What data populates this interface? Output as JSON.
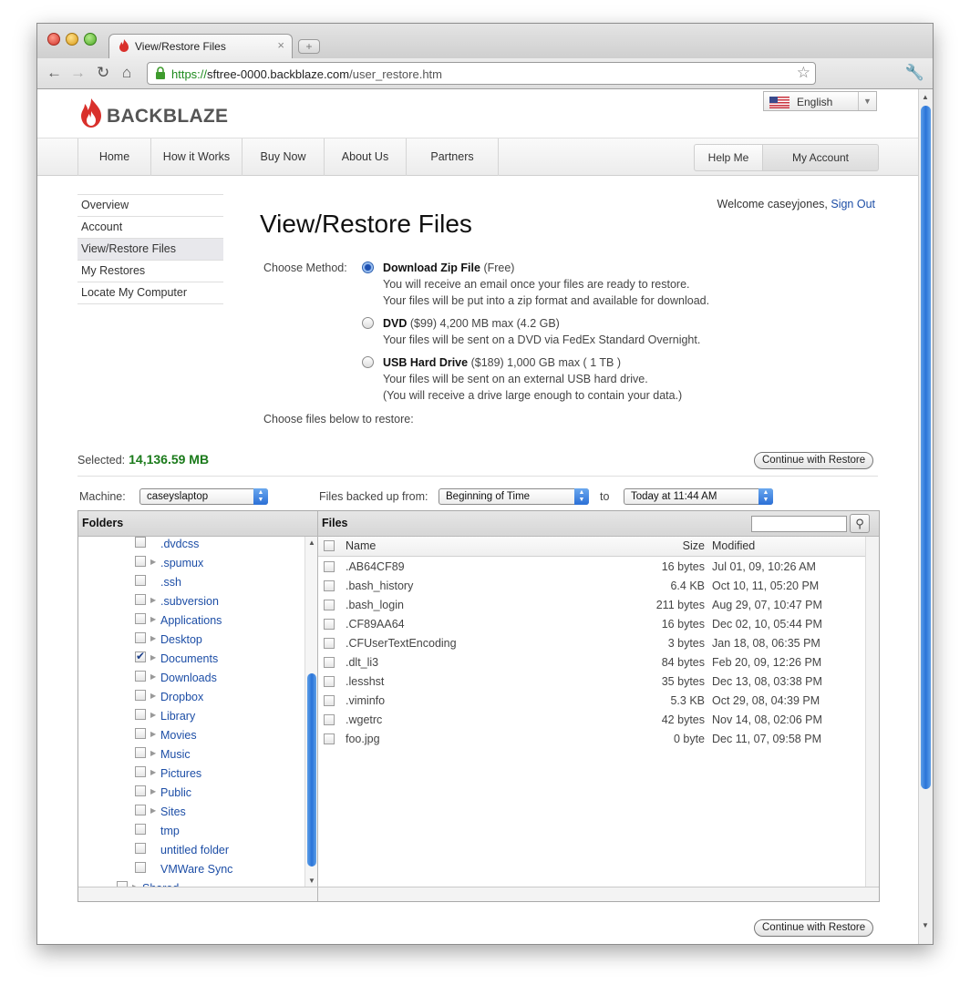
{
  "browser": {
    "tab_title": "View/Restore Files",
    "url_scheme": "https://",
    "url_host": "sftree-0000.backblaze.com",
    "url_path": "/user_restore.htm"
  },
  "site": {
    "logo_text": "BACKBLAZE",
    "language": "English"
  },
  "nav": {
    "items": [
      "Home",
      "How it Works",
      "Buy Now",
      "About Us",
      "Partners"
    ],
    "help": "Help Me",
    "account": "My Account"
  },
  "sidebar": {
    "items": [
      "Overview",
      "Account",
      "View/Restore Files",
      "My Restores",
      "Locate My Computer"
    ],
    "active_index": 2
  },
  "welcome": {
    "text": "Welcome caseyjones,",
    "signout": "Sign Out"
  },
  "page": {
    "title": "View/Restore Files",
    "choose_method_label": "Choose Method:",
    "choose_files": "Choose files below to restore:",
    "selected_label": "Selected:",
    "selected_value": "14,136.59 MB",
    "continue_label": "Continue with Restore"
  },
  "methods": [
    {
      "name": "Download Zip File",
      "detail": "(Free)",
      "lines": [
        "You will receive an email once your files are ready to restore.",
        "Your files will be put into a zip format and available for download."
      ],
      "selected": true
    },
    {
      "name": "DVD",
      "detail": "($99) 4,200 MB max (4.2 GB)",
      "lines": [
        "Your files will be sent on a DVD via FedEx Standard Overnight."
      ],
      "selected": false
    },
    {
      "name": "USB Hard Drive",
      "detail": "($189) 1,000 GB max ( 1 TB )",
      "lines": [
        "Your files will be sent on an external USB hard drive.",
        "(You will receive a drive large enough to contain your data.)"
      ],
      "selected": false
    }
  ],
  "filters": {
    "machine_label": "Machine:",
    "machine_value": "caseyslaptop",
    "backed_up_label": "Files backed up from:",
    "from_value": "Beginning of Time",
    "to_label": "to",
    "to_value": "Today at 11:44 AM"
  },
  "folders_pane": {
    "header": "Folders",
    "items": [
      {
        "name": ".dvdcss",
        "expandable": false,
        "checked": false
      },
      {
        "name": ".spumux",
        "expandable": true,
        "checked": false
      },
      {
        "name": ".ssh",
        "expandable": false,
        "checked": false
      },
      {
        "name": ".subversion",
        "expandable": true,
        "checked": false
      },
      {
        "name": "Applications",
        "expandable": true,
        "checked": false
      },
      {
        "name": "Desktop",
        "expandable": true,
        "checked": false
      },
      {
        "name": "Documents",
        "expandable": true,
        "checked": true
      },
      {
        "name": "Downloads",
        "expandable": true,
        "checked": false
      },
      {
        "name": "Dropbox",
        "expandable": true,
        "checked": false
      },
      {
        "name": "Library",
        "expandable": true,
        "checked": false
      },
      {
        "name": "Movies",
        "expandable": true,
        "checked": false
      },
      {
        "name": "Music",
        "expandable": true,
        "checked": false
      },
      {
        "name": "Pictures",
        "expandable": true,
        "checked": false
      },
      {
        "name": "Public",
        "expandable": true,
        "checked": false
      },
      {
        "name": "Sites",
        "expandable": true,
        "checked": false
      },
      {
        "name": "tmp",
        "expandable": false,
        "checked": false
      },
      {
        "name": "untitled folder",
        "expandable": false,
        "checked": false
      },
      {
        "name": "VMWare Sync",
        "expandable": false,
        "checked": false
      }
    ],
    "partial_item": "Shared"
  },
  "files_pane": {
    "header": "Files",
    "columns": {
      "name": "Name",
      "size": "Size",
      "modified": "Modified"
    },
    "rows": [
      {
        "name": ".AB64CF89",
        "size": "16 bytes",
        "modified": "Jul 01, 09, 10:26 AM"
      },
      {
        "name": ".bash_history",
        "size": "6.4 KB",
        "modified": "Oct 10, 11, 05:20 PM"
      },
      {
        "name": ".bash_login",
        "size": "211 bytes",
        "modified": "Aug 29, 07, 10:47 PM"
      },
      {
        "name": ".CF89AA64",
        "size": "16 bytes",
        "modified": "Dec 02, 10, 05:44 PM"
      },
      {
        "name": ".CFUserTextEncoding",
        "size": "3 bytes",
        "modified": "Jan 18, 08, 06:35 PM"
      },
      {
        "name": ".dlt_li3",
        "size": "84 bytes",
        "modified": "Feb 20, 09, 12:26 PM"
      },
      {
        "name": ".lesshst",
        "size": "35 bytes",
        "modified": "Dec 13, 08, 03:38 PM"
      },
      {
        "name": ".viminfo",
        "size": "5.3 KB",
        "modified": "Oct 29, 08, 04:39 PM"
      },
      {
        "name": ".wgetrc",
        "size": "42 bytes",
        "modified": "Nov 14, 08, 02:06 PM"
      },
      {
        "name": "foo.jpg",
        "size": "0 byte",
        "modified": "Dec 11, 07, 09:58 PM"
      }
    ]
  },
  "colors": {
    "link": "#1d4ea6",
    "selected_green": "#1a7a1a",
    "logo_red": "#d9302b",
    "scroll_blue": "#2a74d8"
  },
  "icons": {
    "logo": "flame-icon",
    "lock": "lock-icon",
    "bookmark": "star-icon",
    "menu": "wrench-icon",
    "search": "magnifier-icon"
  }
}
